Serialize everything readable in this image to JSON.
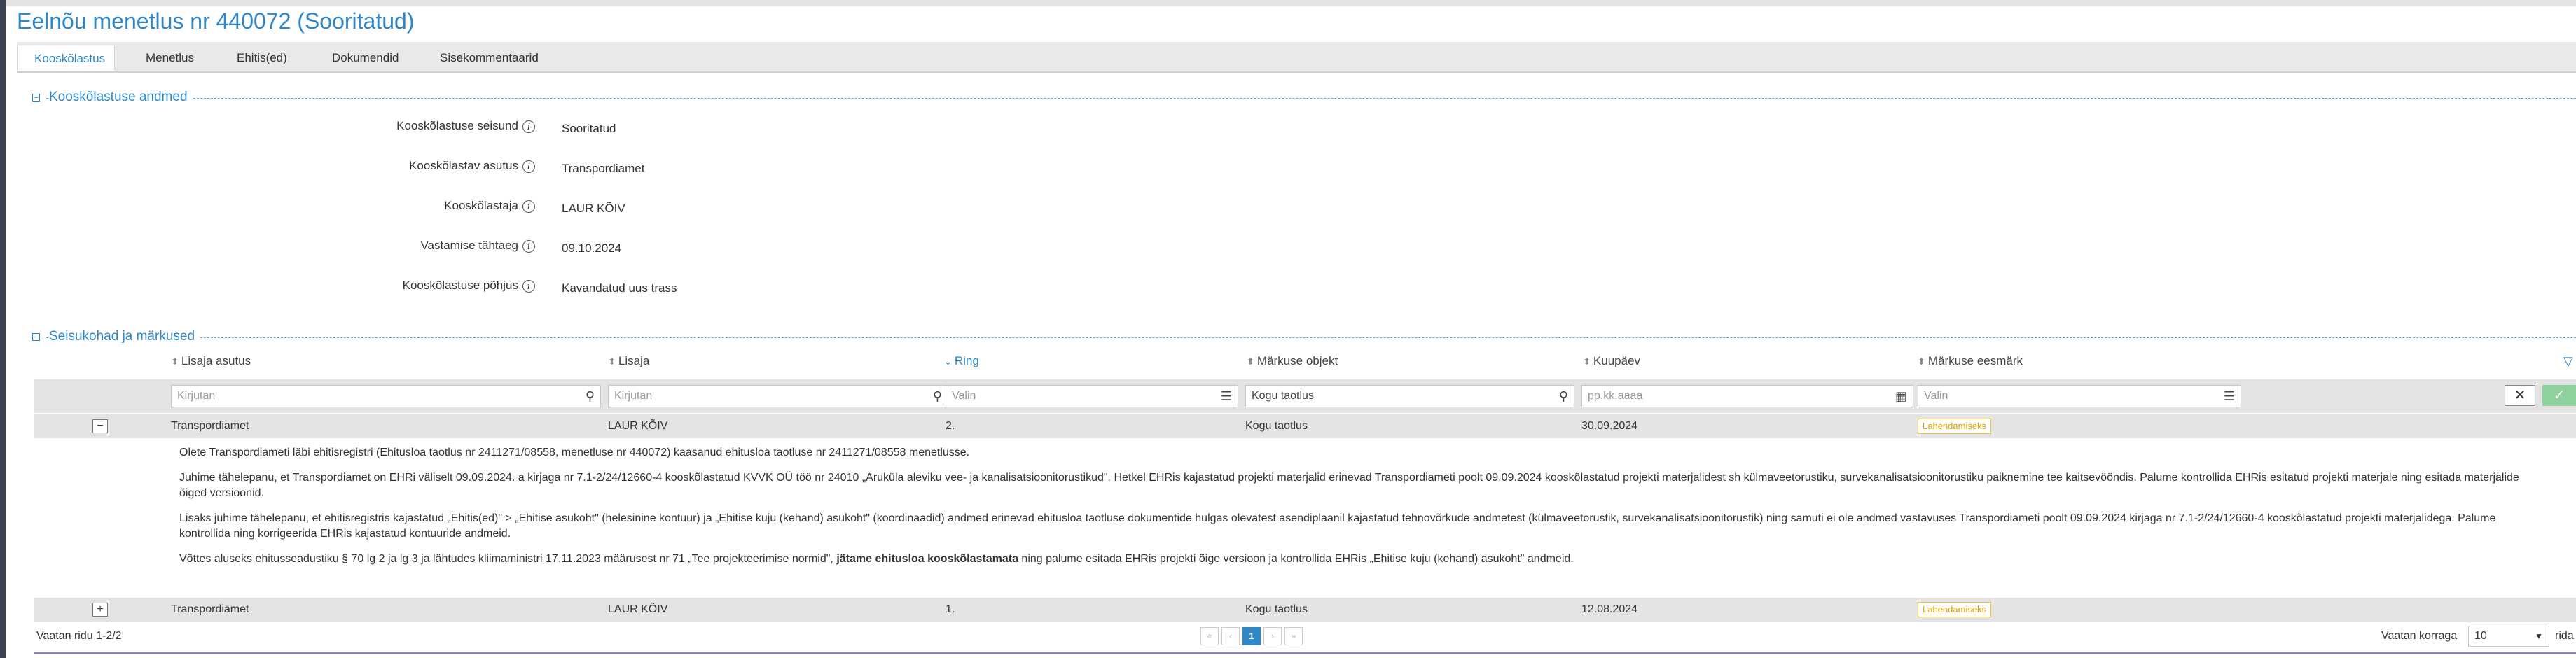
{
  "title": "Eelnõu menetlus nr 440072 (Sooritatud)",
  "tabs": [
    {
      "label": "Kooskõlastus",
      "active": true
    },
    {
      "label": "Menetlus"
    },
    {
      "label": "Ehitis(ed)"
    },
    {
      "label": "Dokumendid"
    },
    {
      "label": "Sisekommentaarid"
    }
  ],
  "section1": {
    "toggle": "−",
    "title": "Kooskõlastuse andmed",
    "fields": [
      {
        "label": "Kooskõlastuse seisund",
        "value": "Sooritatud"
      },
      {
        "label": "Kooskõlastav asutus",
        "value": "Transpordiamet"
      },
      {
        "label": "Kooskõlastaja",
        "value": "LAUR KÕIV"
      },
      {
        "label": "Vastamise tähtaeg",
        "value": "09.10.2024"
      },
      {
        "label": "Kooskõlastuse põhjus",
        "value": "Kavandatud uus trass"
      }
    ],
    "info_icon": "i"
  },
  "section2": {
    "toggle": "−",
    "title": "Seisukohad ja märkused",
    "columns": [
      {
        "label": "Lisaja asutus",
        "sort_icon": "⬍"
      },
      {
        "label": "Lisaja",
        "sort_icon": "⬍"
      },
      {
        "label": "Ring",
        "sort_icon": "⌄"
      },
      {
        "label": "Märkuse objekt",
        "sort_icon": "⬍"
      },
      {
        "label": "Kuupäev",
        "sort_icon": "⬍"
      },
      {
        "label": "Märkuse eesmärk",
        "sort_icon": "⬍"
      }
    ],
    "filters": {
      "lisaja_asutus": {
        "placeholder": "Kirjutan"
      },
      "lisaja": {
        "placeholder": "Kirjutan"
      },
      "ring": {
        "placeholder": "Valin"
      },
      "markuse_objekt": {
        "value": "Kogu taotlus"
      },
      "kuupaev": {
        "placeholder": "pp.kk.aaaa"
      },
      "markuse_eesmark": {
        "placeholder": "Valin"
      },
      "clear_symbol": "✕",
      "apply_symbol": "✓",
      "funnel_symbol": "▽"
    },
    "rows": [
      {
        "toggle": "−",
        "asutus": "Transpordiamet",
        "lisaja": "LAUR KÕIV",
        "ring": "2.",
        "objekt": "Kogu taotlus",
        "kuupaev": "30.09.2024",
        "eesmark": "Lahendamiseks",
        "detail": {
          "p1": "Olete Transpordiameti läbi ehitisregistri (Ehitusloa taotlus nr 2411271/08558, menetluse nr 440072) kaasanud ehitusloa taotluse nr 2411271/08558 menetlusse.",
          "p2": "Juhime tähelepanu, et Transpordiamet on EHRi väliselt 09.09.2024. a kirjaga nr 7.1-2/24/12660-4 kooskõlastatud KVVK OÜ töö nr 24010 „Aruküla aleviku vee- ja kanalisatsioonitorustikud\". Hetkel EHRis kajastatud projekti materjalid erinevad Transpordiameti poolt 09.09.2024 kooskõlastatud projekti materjalidest sh külmaveetorustiku, survekanalisatsioonitorustiku paiknemine tee kaitsevööndis. Palume kontrollida EHRis esitatud projekti materjale ning esitada materjalide õiged versioonid.",
          "p3": "Lisaks juhime tähelepanu, et ehitisregistris kajastatud „Ehitis(ed)\" > „Ehitise asukoht\" (helesinine kontuur) ja „Ehitise kuju (kehand) asukoht\" (koordinaadid) andmed erinevad ehitusloa taotluse dokumentide hulgas olevatest asendiplaanil kajastatud tehnovõrkude andmetest (külmaveetorustik, survekanalisatsioonitorustik) ning samuti ei ole andmed vastavuses Transpordiameti poolt 09.09.2024 kirjaga nr 7.1-2/24/12660-4 kooskõlastatud projekti materjalidega. Palume kontrollida ning korrigeerida EHRis kajastatud kontuuride andmeid.",
          "p4_a": "Võttes aluseks ehitusseadustiku § 70 lg 2 ja lg 3 ja lähtudes kliimaministri 17.11.2023 määrusest nr 71 „Tee projekteerimise normid\", ",
          "p4_b": "jätame ehitusloa kooskõlastamata",
          "p4_c": " ning palume esitada EHRis projekti õige versioon ja kontrollida EHRis „Ehitise kuju (kehand) asukoht\" andmeid."
        }
      },
      {
        "toggle": "+",
        "asutus": "Transpordiamet",
        "lisaja": "LAUR KÕIV",
        "ring": "1.",
        "objekt": "Kogu taotlus",
        "kuupaev": "12.08.2024",
        "eesmark": "Lahendamiseks"
      }
    ],
    "footer": {
      "rows_info": "Vaatan ridu 1-2/2",
      "pager": {
        "first": "«",
        "prev": "‹",
        "current": "1",
        "next": "›",
        "last": "»"
      },
      "per_page_label": "Vaatan korraga",
      "per_page_value": "10",
      "per_page_suffix": "rida"
    }
  },
  "colors": {
    "accent": "#2f87c8",
    "badge": "#f1c232",
    "ok": "#8fd19e"
  }
}
